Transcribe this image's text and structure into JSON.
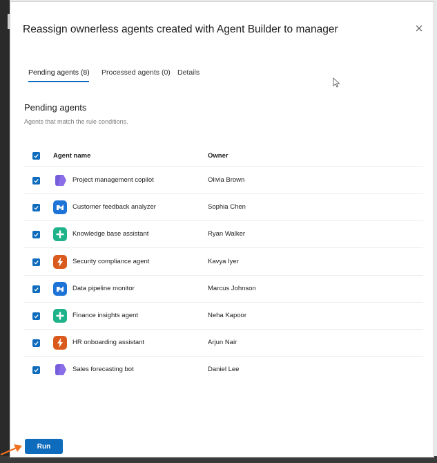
{
  "dialog": {
    "title": "Reassign ownerless agents created with Agent Builder to manager",
    "close_icon": "close-icon"
  },
  "tabs": [
    {
      "label": "Pending agents (8)",
      "active": true
    },
    {
      "label": "Processed agents (0)",
      "active": false
    },
    {
      "label": "Details",
      "active": false
    }
  ],
  "section": {
    "title": "Pending agents",
    "subtitle": "Agents that match the rule conditions."
  },
  "table": {
    "columns": [
      "Agent name",
      "Owner"
    ],
    "rows": [
      {
        "name": "Project management copilot",
        "owner": "Olivia Brown",
        "icon": "purple-hexagon-icon",
        "checked": true
      },
      {
        "name": "Customer feedback analyzer",
        "owner": "Sophia Chen",
        "icon": "blue-agent-icon",
        "checked": true
      },
      {
        "name": "Knowledge base assistant",
        "owner": "Ryan Walker",
        "icon": "green-plus-icon",
        "checked": true
      },
      {
        "name": "Security compliance agent",
        "owner": "Kavya Iyer",
        "icon": "orange-lightning-icon",
        "checked": true
      },
      {
        "name": "Data pipeline monitor",
        "owner": "Marcus Johnson",
        "icon": "blue-agent-icon",
        "checked": true
      },
      {
        "name": "Finance insights agent",
        "owner": "Neha Kapoor",
        "icon": "green-plus-icon",
        "checked": true
      },
      {
        "name": "HR onboarding assistant",
        "owner": "Arjun Nair",
        "icon": "orange-lightning-icon",
        "checked": true
      },
      {
        "name": "Sales forecasting bot",
        "owner": "Daniel Lee",
        "icon": "purple-hexagon-icon",
        "checked": true
      }
    ]
  },
  "footer": {
    "run_label": "Run"
  },
  "colors": {
    "accent": "#0f6cbd",
    "purple": "#8a6ee8",
    "blue": "#1e73d6",
    "green": "#1fb38a",
    "orange": "#d95a1c",
    "marker": "#f0701e"
  }
}
